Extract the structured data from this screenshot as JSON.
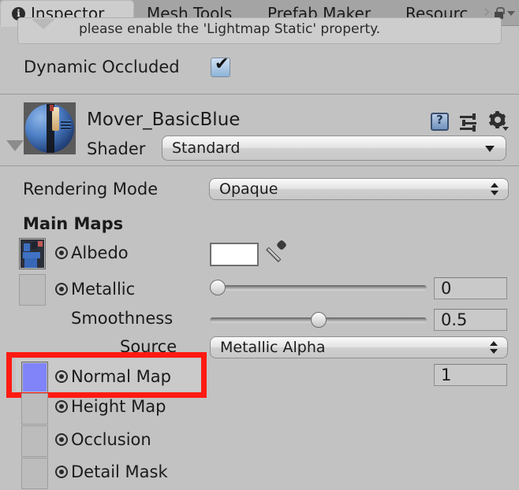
{
  "window": {
    "background": "#c2c2c2",
    "accent_red": "#ff1a12"
  },
  "tabs": [
    {
      "label": "Inspector",
      "icon": "info-icon",
      "active": true
    },
    {
      "label": "Mesh Tools",
      "active": false
    },
    {
      "label": "Prefab Maker",
      "active": false
    },
    {
      "label": "Resourc",
      "active": false,
      "truncated": true
    }
  ],
  "tabbar_right": {
    "overflow_icon": "chevron-right-icon",
    "lock_icon": "lock-icon",
    "menu_icon": "chevron-down-icon"
  },
  "warning": {
    "text": "please enable the 'Lightmap Static' property.",
    "icon": "warning-chevron-icon"
  },
  "occlusion_row": {
    "label": "Dynamic Occluded",
    "checked": true,
    "check_glyph": "✔"
  },
  "material": {
    "name": "Mover_BasicBlue",
    "preview_icon": "material-sphere-preview",
    "foldout_icon": "foldout-triangle-icon",
    "header_icons": [
      {
        "name": "help-icon",
        "glyph": "?"
      },
      {
        "name": "preset-icon"
      },
      {
        "name": "gear-icon"
      }
    ],
    "shader": {
      "label": "Shader",
      "value": "Standard"
    }
  },
  "rendering_mode": {
    "label": "Rendering Mode",
    "value": "Opaque"
  },
  "sections": {
    "main_maps": "Main Maps"
  },
  "properties": [
    {
      "key": "albedo",
      "label": "Albedo",
      "slot": "filled-albedo",
      "color_value": "#ffffff",
      "has_color": true,
      "has_eyedropper": true
    },
    {
      "key": "metallic",
      "label": "Metallic",
      "slot": "empty",
      "slider": 0,
      "value": "0"
    },
    {
      "key": "smoothness",
      "label": "Smoothness",
      "slider": 0.5,
      "value": "0.5"
    },
    {
      "key": "source",
      "label": "Source",
      "popup_value": "Metallic Alpha"
    },
    {
      "key": "normal_map",
      "label": "Normal Map",
      "slot": "filled-normal",
      "value": "1",
      "highlighted": true
    },
    {
      "key": "height_map",
      "label": "Height Map",
      "slot": "empty"
    },
    {
      "key": "occlusion",
      "label": "Occlusion",
      "slot": "empty"
    },
    {
      "key": "detail_mask",
      "label": "Detail Mask",
      "slot": "empty"
    }
  ]
}
